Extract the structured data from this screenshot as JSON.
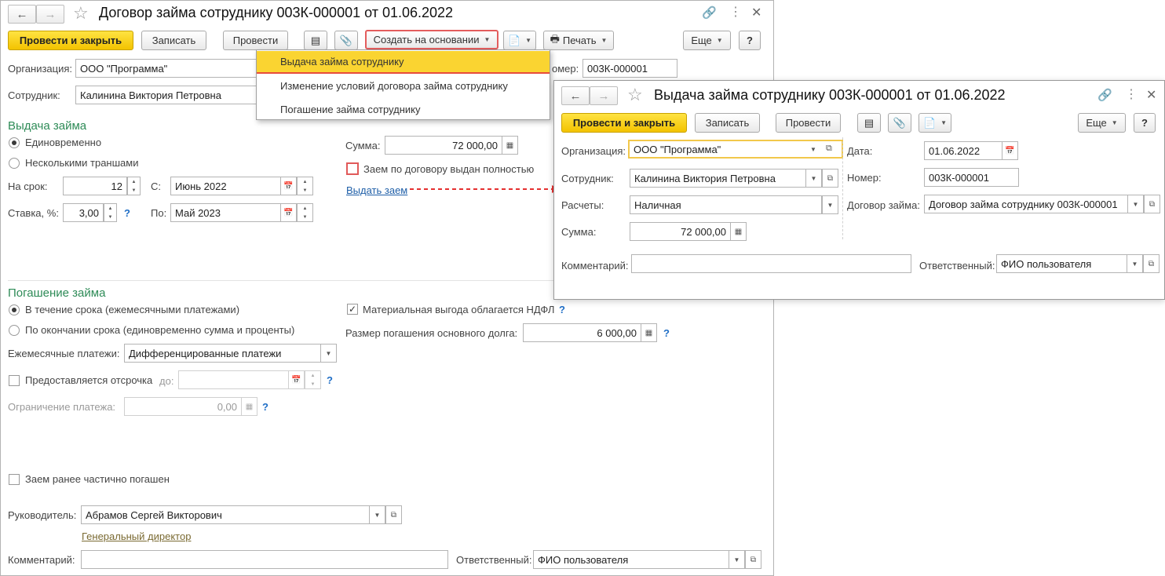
{
  "main": {
    "title": "Договор займа сотруднику 003К-000001 от 01.06.2022",
    "toolbar": {
      "post_close": "Провести и закрыть",
      "save": "Записать",
      "post": "Провести",
      "create_based": "Создать на основании",
      "print": "Печать",
      "more": "Еще",
      "help": "?"
    },
    "menu": [
      "Выдача займа сотруднику",
      "Изменение условий договора займа сотруднику",
      "Погашение займа сотруднику"
    ],
    "labels": {
      "organization": "Организация:",
      "employee": "Сотрудник:",
      "number": "омер:",
      "issue_section": "Выдача займа",
      "once": "Единовременно",
      "tranches": "Несколькими траншами",
      "term": "На срок:",
      "from": "С:",
      "rate": "Ставка, %:",
      "to": "По:",
      "sum": "Сумма:",
      "issued_full": "Заем по договору выдан полностью",
      "issue_link": "Выдать заем",
      "repay_section": "Погашение займа",
      "repay_monthly": "В течение срока (ежемесячными платежами)",
      "repay_end": "По окончании срока (единовременно сумма и проценты)",
      "monthly_payments": "Ежемесячные платежи:",
      "deferral": "Предоставляется отсрочка",
      "deferral_to": "до:",
      "payment_limit": "Ограничение платежа:",
      "material_benefit": "Материальная выгода облагается НДФЛ",
      "principal_size": "Размер погашения основного долга:",
      "partially_repaid": "Заем ранее частично погашен",
      "manager": "Руководитель:",
      "position": "Генеральный директор",
      "comment": "Комментарий:",
      "responsible": "Ответственный:"
    },
    "values": {
      "organization": "ООО \"Программа\"",
      "employee": "Калинина Виктория Петровна",
      "number": "003К-000001",
      "term": "12",
      "from": "Июнь 2022",
      "rate": "3,00",
      "to": "Май 2023",
      "sum": "72 000,00",
      "monthly_payments": "Дифференцированные платежи",
      "deferral_to": "",
      "payment_limit": "0,00",
      "principal_size": "6 000,00",
      "manager": "Абрамов Сергей Викторович",
      "comment": "",
      "responsible": "ФИО пользователя"
    }
  },
  "issue": {
    "title": "Выдача займа сотруднику 003К-000001 от 01.06.2022",
    "toolbar": {
      "post_close": "Провести и закрыть",
      "save": "Записать",
      "post": "Провести",
      "more": "Еще",
      "help": "?"
    },
    "labels": {
      "organization": "Организация:",
      "employee": "Сотрудник:",
      "payments": "Расчеты:",
      "sum": "Сумма:",
      "date": "Дата:",
      "number": "Номер:",
      "contract": "Договор займа:",
      "comment": "Комментарий:",
      "responsible": "Ответственный:"
    },
    "values": {
      "organization": "ООО \"Программа\"",
      "employee": "Калинина Виктория Петровна",
      "payments": "Наличная",
      "sum": "72 000,00",
      "date": "01.06.2022",
      "number": "003К-000001",
      "contract": "Договор займа сотруднику 003К-000001",
      "comment": "",
      "responsible": "ФИО пользователя"
    }
  },
  "colors": {
    "primary_button": "#f3c300",
    "section_title": "#2e8b57",
    "link": "#1f5fa8",
    "menu_selected": "#fad431",
    "arrow": "#e53030"
  }
}
